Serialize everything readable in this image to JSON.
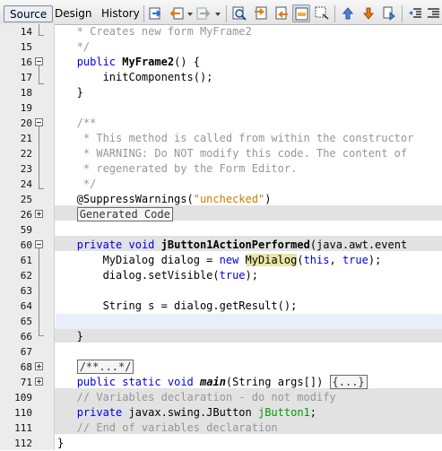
{
  "toolbar": {
    "tabs": [
      "Source",
      "Design",
      "History"
    ],
    "icons": [
      "last-edit-icon",
      "back-icon",
      "forward-icon",
      "find-icon",
      "find-previous-icon",
      "find-next-icon",
      "toggle-highlight-icon",
      "toggle-rect-select-icon",
      "previous-bookmark-icon",
      "next-bookmark-icon",
      "toggle-bookmark-icon",
      "shift-left-icon",
      "shift-right-icon"
    ]
  },
  "lines": [
    {
      "n": "14",
      "t": "   * Creates new form MyFrame2"
    },
    {
      "n": "15",
      "t": "   */"
    },
    {
      "n": "16",
      "a": "   ",
      "b": "public",
      "c": " ",
      "d": "MyFrame2",
      "e": "() {"
    },
    {
      "n": "17",
      "t": "       initComponents();"
    },
    {
      "n": "18",
      "t": "   }"
    },
    {
      "n": "19",
      "t": ""
    },
    {
      "n": "20",
      "t": "   /**"
    },
    {
      "n": "21",
      "t": "    * This method is called from within the constructor"
    },
    {
      "n": "22",
      "t": "    * WARNING: Do NOT modify this code. The content of"
    },
    {
      "n": "23",
      "t": "    * regenerated by the Form Editor."
    },
    {
      "n": "24",
      "t": "    */"
    },
    {
      "n": "25",
      "a": "   @SuppressWarnings(",
      "b": "\"unchecked\"",
      "c": ")"
    },
    {
      "n": "26",
      "a": "   ",
      "b": "Generated Code"
    },
    {
      "n": "59",
      "t": ""
    },
    {
      "n": "60",
      "a": "   ",
      "b": "private",
      "c": " ",
      "d": "void",
      "e": " ",
      "f": "jButton1ActionPerformed",
      "g": "(java.awt.event"
    },
    {
      "n": "61",
      "a": "       MyDialog dialog = ",
      "b": "new",
      "c": " ",
      "d": "MyDialog",
      "e": "(",
      "f": "this",
      "g": ", ",
      "h": "true",
      "i": ");"
    },
    {
      "n": "62",
      "a": "       dialog.setVisible(",
      "b": "true",
      "c": ");"
    },
    {
      "n": "63",
      "t": ""
    },
    {
      "n": "64",
      "t": "       String s = dialog.getResult();"
    },
    {
      "n": "65",
      "t": ""
    },
    {
      "n": "66",
      "t": "   }"
    },
    {
      "n": "67",
      "t": ""
    },
    {
      "n": "68",
      "a": "   ",
      "b": "/**...*/"
    },
    {
      "n": "71",
      "a": "   ",
      "b": "public",
      "c": " ",
      "d": "static",
      "e": " ",
      "f": "void",
      "g": " ",
      "h": "main",
      "i": "(String args[]) ",
      "j": "{...}"
    },
    {
      "n": "109",
      "t": "   // Variables declaration - do not modify"
    },
    {
      "n": "110",
      "a": "   ",
      "b": "private",
      "c": " javax.swing.JButton ",
      "d": "jButton1",
      "e": ";"
    },
    {
      "n": "111",
      "t": "   // End of variables declaration"
    },
    {
      "n": "112",
      "t": "}"
    }
  ],
  "colors": {
    "keyword": "#0000e6",
    "comment": "#969696",
    "string": "#ce7b00",
    "field": "#009900",
    "guarded_bg": "#e2e2e2",
    "gutter_bg": "#ececec"
  }
}
